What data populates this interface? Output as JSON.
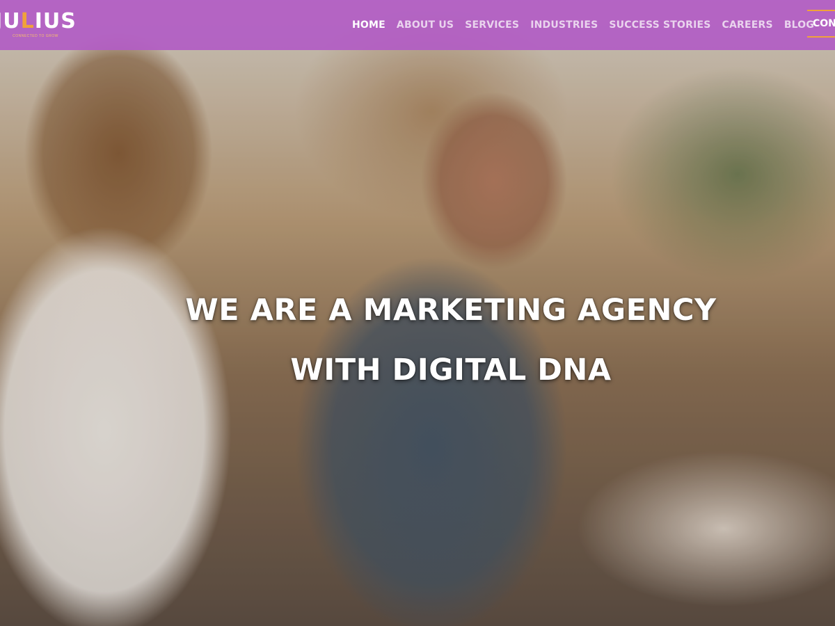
{
  "brand": {
    "logo_text_left": "JU",
    "logo_text_accent": "L",
    "logo_text_right": "IUS",
    "tagline": "Connected to grow",
    "colors": {
      "header_bg": "#b25cc4",
      "accent": "#f0a23a",
      "text": "#ffffff"
    }
  },
  "nav": {
    "items": [
      {
        "label": "HOME",
        "active": true
      },
      {
        "label": "ABOUT US",
        "active": false
      },
      {
        "label": "SERVICES",
        "active": false
      },
      {
        "label": "INDUSTRIES",
        "active": false
      },
      {
        "label": "SUCCESS STORIES",
        "active": false
      },
      {
        "label": "CAREERS",
        "active": false
      },
      {
        "label": "BLOG",
        "active": false
      }
    ],
    "cta_label": "CON"
  },
  "hero": {
    "headline_line1": "WE ARE A MARKETING AGENCY",
    "headline_line2": "WITH DIGITAL DNA"
  }
}
